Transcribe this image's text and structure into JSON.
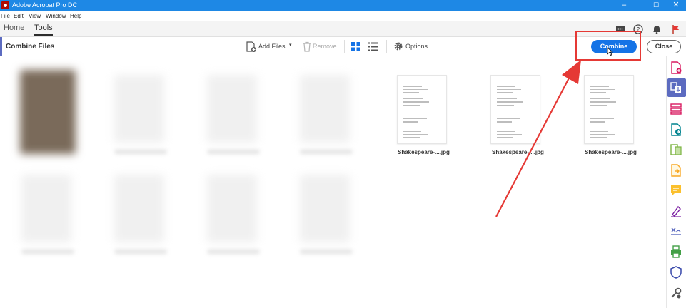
{
  "window": {
    "title": "Adobe Acrobat Pro DC",
    "controls": [
      "–",
      "☐",
      "✕"
    ]
  },
  "menu": [
    "File",
    "Edit",
    "View",
    "Window",
    "Help"
  ],
  "tabs": [
    {
      "label": "Home",
      "active": false
    },
    {
      "label": "Tools",
      "active": true
    }
  ],
  "toolbar": {
    "title": "Combine Files",
    "add_files": "Add Files...",
    "remove": "Remove",
    "options": "Options",
    "combine": "Combine",
    "close": "Close"
  },
  "files": [
    {
      "label": "Shakespeare-....jpg"
    },
    {
      "label": "Shakespeare-....jpg"
    },
    {
      "label": "Shakespeare-....jpg"
    }
  ],
  "colors": {
    "titlebar": "#1e88e5",
    "combine_button": "#1473e6",
    "annotation": "#e53935",
    "rail_selected": "#5c6bc0"
  },
  "right_rail_icons": [
    "create-pdf-icon",
    "combine-files-icon",
    "organize-pages-icon",
    "export-pdf-icon",
    "edit-pdf-icon",
    "export-icon",
    "comment-icon",
    "fill-sign-icon",
    "request-signature-icon",
    "print-icon",
    "protect-icon",
    "more-tools-icon"
  ]
}
